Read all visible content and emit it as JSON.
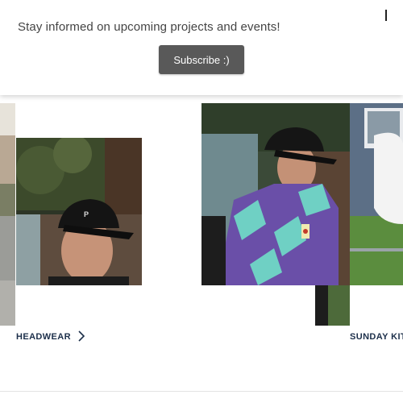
{
  "banner": {
    "message": "Stay informed on upcoming projects and events!",
    "subscribe_label": "Subscribe :)"
  },
  "categories": [
    {
      "label": "HEADWEAR",
      "icon": "chevron-right-icon"
    },
    {
      "label": "SUNDAY KIT"
    }
  ],
  "colors": {
    "button_bg": "#595959",
    "label_text": "#1c2f4a",
    "banner_text": "#444444"
  }
}
